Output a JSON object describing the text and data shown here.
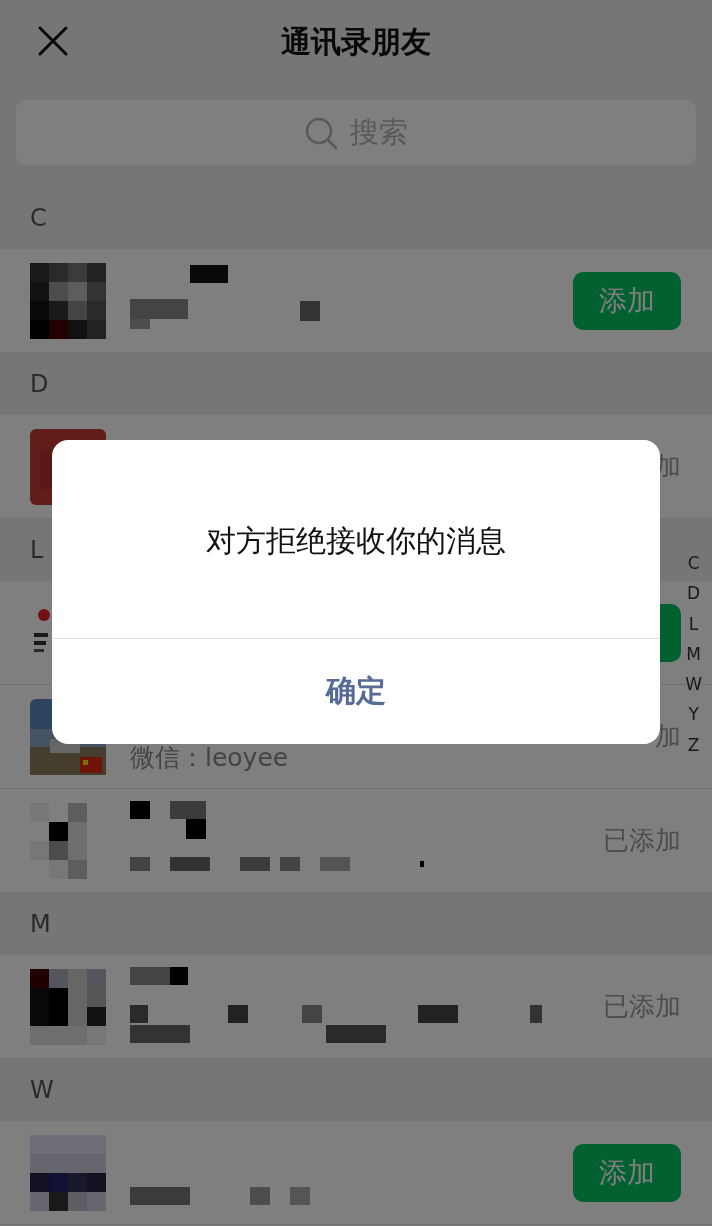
{
  "header": {
    "title": "通讯录朋友"
  },
  "search": {
    "placeholder": "搜索"
  },
  "sections": [
    {
      "letter": "C",
      "contacts": [
        {
          "action": {
            "kind": "add",
            "label": "添加"
          }
        }
      ]
    },
    {
      "letter": "D",
      "contacts": [
        {
          "action": {
            "kind": "added",
            "label": "加"
          }
        }
      ]
    },
    {
      "letter": "L",
      "contacts": [
        {
          "action": {
            "kind": "add"
          }
        },
        {
          "wechat_id": "微信：leoyee",
          "action": {
            "kind": "added",
            "label": "加"
          }
        },
        {
          "action": {
            "kind": "added",
            "label": "已添加"
          }
        }
      ]
    },
    {
      "letter": "M",
      "contacts": [
        {
          "action": {
            "kind": "added",
            "label": "已添加"
          }
        }
      ]
    },
    {
      "letter": "W",
      "contacts": [
        {
          "action": {
            "kind": "add",
            "label": "添加"
          }
        }
      ]
    }
  ],
  "index": [
    "C",
    "D",
    "L",
    "M",
    "W",
    "Y",
    "Z"
  ],
  "dialog": {
    "message": "对方拒绝接收你的消息",
    "button": "确定"
  }
}
